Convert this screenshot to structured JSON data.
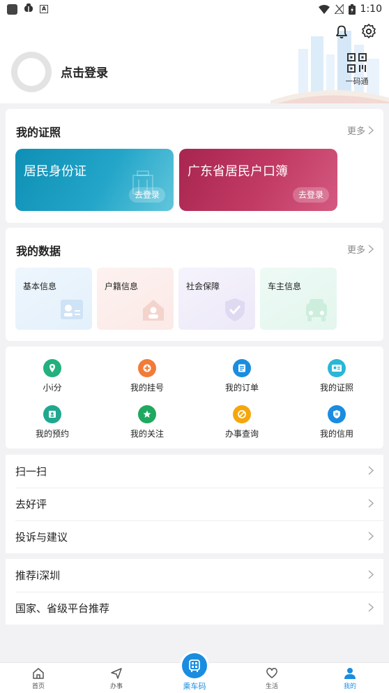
{
  "status_bar": {
    "time": "1:10"
  },
  "header": {
    "login_text": "点击登录",
    "qr_label": "一码通"
  },
  "certificates": {
    "title": "我的证照",
    "more": "更多",
    "cards": [
      {
        "title": "居民身份证",
        "button": "去登录"
      },
      {
        "title": "广东省居民户口簿",
        "button": "去登录"
      }
    ]
  },
  "my_data": {
    "title": "我的数据",
    "more": "更多",
    "tiles": [
      {
        "label": "基本信息"
      },
      {
        "label": "户籍信息"
      },
      {
        "label": "社会保障"
      },
      {
        "label": "车主信息"
      }
    ]
  },
  "shortcuts": [
    {
      "label": "小i分",
      "color": "#22b07d",
      "icon": "location-pin-icon"
    },
    {
      "label": "我的挂号",
      "color": "#f27b38",
      "icon": "medical-cross-icon"
    },
    {
      "label": "我的订单",
      "color": "#1a8de0",
      "icon": "order-list-icon"
    },
    {
      "label": "我的证照",
      "color": "#2ab7d6",
      "icon": "id-card-icon"
    },
    {
      "label": "我的预约",
      "color": "#1fa88f",
      "icon": "appointment-icon"
    },
    {
      "label": "我的关注",
      "color": "#1fa860",
      "icon": "star-icon"
    },
    {
      "label": "办事查询",
      "color": "#f4a70d",
      "icon": "search-icon"
    },
    {
      "label": "我的信用",
      "color": "#1a8de0",
      "icon": "credit-shield-icon"
    }
  ],
  "menu_group_1": [
    {
      "label": "扫一扫"
    },
    {
      "label": "去好评"
    },
    {
      "label": "投诉与建议"
    }
  ],
  "menu_group_2": [
    {
      "label": "推荐i深圳"
    },
    {
      "label": "国家、省级平台推荐"
    }
  ],
  "tab_bar": {
    "tabs": [
      {
        "label": "首页",
        "icon": "home-icon"
      },
      {
        "label": "办事",
        "icon": "navigation-arrow-icon"
      },
      {
        "label": "乘车码",
        "icon": "bus-qr-icon"
      },
      {
        "label": "生活",
        "icon": "heart-icon"
      },
      {
        "label": "我的",
        "icon": "person-icon"
      }
    ],
    "active_color": "#1a8de0"
  }
}
